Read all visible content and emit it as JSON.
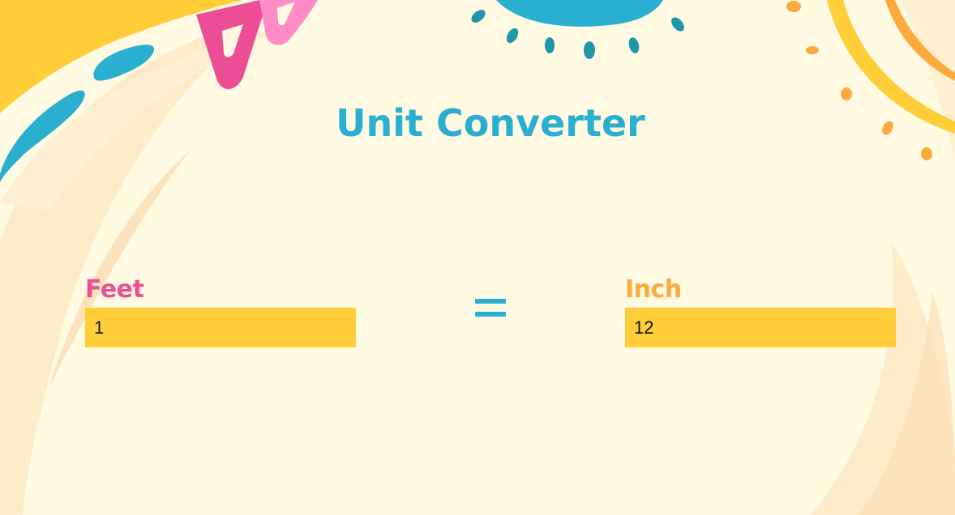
{
  "app": {
    "title": "Unit Converter"
  },
  "converter": {
    "from": {
      "label": "Feet",
      "value": "1"
    },
    "equals_icon": "equals-icon",
    "to": {
      "label": "Inch",
      "value": "12"
    }
  },
  "colors": {
    "background": "#FFFAE1",
    "title": "#2AAFD1",
    "from_label": "#EC4E95",
    "to_label": "#FBAA3B",
    "input_background": "#FFCE38",
    "equals": "#2AAFD1",
    "accent_yellow": "#FFCE38",
    "accent_pink": "#EC4E95",
    "accent_light_pink": "#FF8CC6",
    "accent_blue": "#2AAFD1",
    "accent_teal": "#1E98A8",
    "accent_orange": "#FBAA3B"
  }
}
